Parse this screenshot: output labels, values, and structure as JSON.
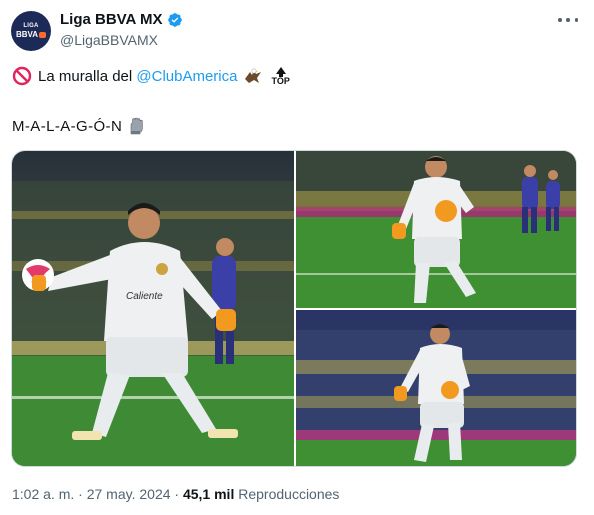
{
  "account": {
    "display_name": "Liga BBVA MX",
    "handle": "@LigaBBVAMX",
    "avatar_text_top": "LIGA",
    "avatar_text_bottom": "BBVA"
  },
  "tweet": {
    "line1_prefix": "La muralla del ",
    "mention": "@ClubAmerica",
    "top_emoji_text": "TOP",
    "line2": "M-A-L-A-G-Ó-N"
  },
  "media": {
    "jersey_sponsor": "Caliente"
  },
  "meta": {
    "time": "1:02 a. m.",
    "separator": "·",
    "date": "27 may. 2024",
    "views_count": "45,1 mil",
    "views_label": "Reproducciones"
  },
  "icons": [
    "verified-badge-icon",
    "more-options-icon",
    "no-entry-icon",
    "eagle-icon",
    "top-arrow-icon",
    "glove-icon"
  ],
  "colors": {
    "link": "#1d9bf0",
    "verified": "#1d9bf0",
    "secondary_text": "#536471",
    "primary_text": "#0f1419"
  }
}
